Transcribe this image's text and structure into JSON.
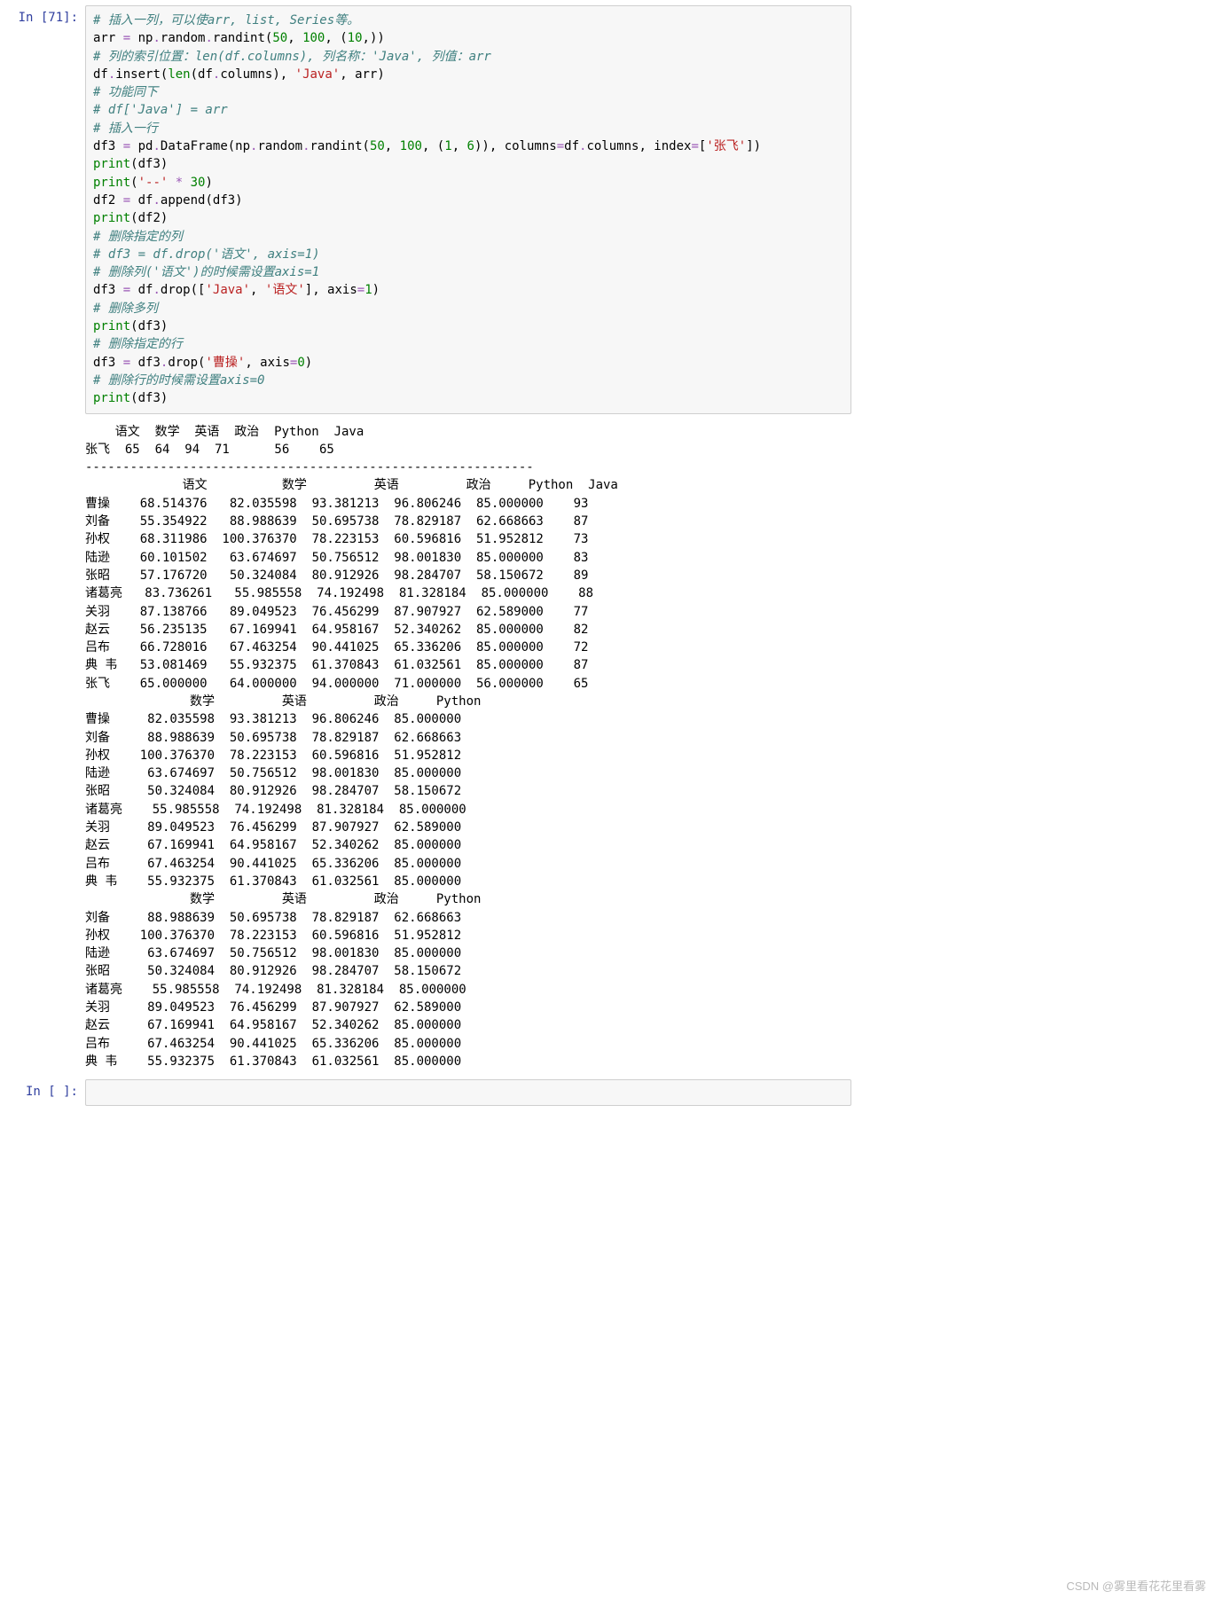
{
  "prompts": {
    "in71": "In [71]:",
    "inEmpty": "In [ ]:"
  },
  "code": {
    "l1": "# 插入一列，可以使arr, list, Series等。",
    "l2a": "arr ",
    "l2b": "=",
    "l2c": " np",
    "l2d": ".",
    "l2e": "random",
    "l2f": ".",
    "l2g": "randint(",
    "l2h": "50",
    "l2i": ", ",
    "l2j": "100",
    "l2k": ", (",
    "l2l": "10",
    "l2m": ",))",
    "l3": "# 列的索引位置：len(df.columns), 列名称：'Java', 列值：arr",
    "l4a": "df",
    "l4b": ".",
    "l4c": "insert(",
    "l4d": "len",
    "l4e": "(df",
    "l4f": ".",
    "l4g": "columns), ",
    "l4h": "'Java'",
    "l4i": ", arr)",
    "l5": "# 功能同下",
    "l6": "# df['Java'] = arr",
    "l7": "# 插入一行",
    "l8a": "df3 ",
    "l8b": "=",
    "l8c": " pd",
    "l8d": ".",
    "l8e": "DataFrame(np",
    "l8f": ".",
    "l8g": "random",
    "l8h": ".",
    "l8i": "randint(",
    "l8j": "50",
    "l8k": ", ",
    "l8l": "100",
    "l8m": ", (",
    "l8n": "1",
    "l8o": ", ",
    "l8p": "6",
    "l8q": ")), columns",
    "l8r": "=",
    "l8s": "df",
    "l8t": ".",
    "l8u": "columns, index",
    "l8v": "=",
    "l8w": "[",
    "l8x": "'张飞'",
    "l8y": "])",
    "l9a": "print",
    "l9b": "(df3)",
    "l10a": "print",
    "l10b": "(",
    "l10c": "'--'",
    "l10d": " ",
    "l10e": "*",
    "l10f": " ",
    "l10g": "30",
    "l10h": ")",
    "l11a": "df2 ",
    "l11b": "=",
    "l11c": " df",
    "l11d": ".",
    "l11e": "append(df3)",
    "l12a": "print",
    "l12b": "(df2)",
    "l13": "# 删除指定的列",
    "l14": "# df3 = df.drop('语文', axis=1)",
    "l15": "# 删除列('语文')的时候需设置axis=1",
    "l16a": "df3 ",
    "l16b": "=",
    "l16c": " df",
    "l16d": ".",
    "l16e": "drop([",
    "l16f": "'Java'",
    "l16g": ", ",
    "l16h": "'语文'",
    "l16i": "], axis",
    "l16j": "=",
    "l16k": "1",
    "l16l": ")",
    "l17": "# 删除多列",
    "l18a": "print",
    "l18b": "(df3)",
    "l19": "# 删除指定的行",
    "l20a": "df3 ",
    "l20b": "=",
    "l20c": " df3",
    "l20d": ".",
    "l20e": "drop(",
    "l20f": "'曹操'",
    "l20g": ", axis",
    "l20h": "=",
    "l20i": "0",
    "l20j": ")",
    "l21": "# 删除行的时候需设置axis=0",
    "l22a": "print",
    "l22b": "(df3)"
  },
  "output": "    语文  数学  英语  政治  Python  Java\n张飞  65  64  94  71      56    65\n------------------------------------------------------------\n             语文          数学         英语         政治     Python  Java\n曹操    68.514376   82.035598  93.381213  96.806246  85.000000    93\n刘备    55.354922   88.988639  50.695738  78.829187  62.668663    87\n孙权    68.311986  100.376370  78.223153  60.596816  51.952812    73\n陆逊    60.101502   63.674697  50.756512  98.001830  85.000000    83\n张昭    57.176720   50.324084  80.912926  98.284707  58.150672    89\n诸葛亮   83.736261   55.985558  74.192498  81.328184  85.000000    88\n关羽    87.138766   89.049523  76.456299  87.907927  62.589000    77\n赵云    56.235135   67.169941  64.958167  52.340262  85.000000    82\n吕布    66.728016   67.463254  90.441025  65.336206  85.000000    72\n典 韦   53.081469   55.932375  61.370843  61.032561  85.000000    87\n张飞    65.000000   64.000000  94.000000  71.000000  56.000000    65\n              数学         英语         政治     Python\n曹操     82.035598  93.381213  96.806246  85.000000\n刘备     88.988639  50.695738  78.829187  62.668663\n孙权    100.376370  78.223153  60.596816  51.952812\n陆逊     63.674697  50.756512  98.001830  85.000000\n张昭     50.324084  80.912926  98.284707  58.150672\n诸葛亮    55.985558  74.192498  81.328184  85.000000\n关羽     89.049523  76.456299  87.907927  62.589000\n赵云     67.169941  64.958167  52.340262  85.000000\n吕布     67.463254  90.441025  65.336206  85.000000\n典 韦    55.932375  61.370843  61.032561  85.000000\n              数学         英语         政治     Python\n刘备     88.988639  50.695738  78.829187  62.668663\n孙权    100.376370  78.223153  60.596816  51.952812\n陆逊     63.674697  50.756512  98.001830  85.000000\n张昭     50.324084  80.912926  98.284707  58.150672\n诸葛亮    55.985558  74.192498  81.328184  85.000000\n关羽     89.049523  76.456299  87.907927  62.589000\n赵云     67.169941  64.958167  52.340262  85.000000\n吕布     67.463254  90.441025  65.336206  85.000000\n典 韦    55.932375  61.370843  61.032561  85.000000",
  "watermark": "CSDN @雾里看花花里看雾"
}
